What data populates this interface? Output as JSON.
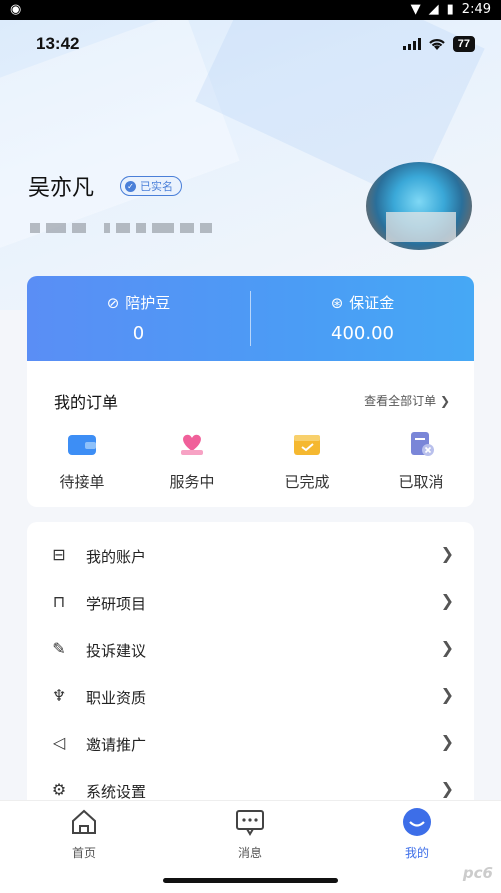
{
  "android_status": {
    "time": "2:49"
  },
  "ios_status": {
    "time": "13:42",
    "battery": "77"
  },
  "profile": {
    "name": "吴亦凡",
    "verified_label": "已实名"
  },
  "assets": [
    {
      "label": "陪护豆",
      "value": "0"
    },
    {
      "label": "保证金",
      "value": "400.00"
    }
  ],
  "orders": {
    "title": "我的订单",
    "view_all": "查看全部订单",
    "items": [
      {
        "label": "待接单",
        "icon": "wallet-icon",
        "color": "#3d8ef5"
      },
      {
        "label": "服务中",
        "icon": "heart-hand-icon",
        "color": "#f0609a"
      },
      {
        "label": "已完成",
        "icon": "box-check-icon",
        "color": "#f5b830"
      },
      {
        "label": "已取消",
        "icon": "doc-cancel-icon",
        "color": "#7a86d8"
      }
    ]
  },
  "menu": [
    {
      "label": "我的账户",
      "icon": "account-icon"
    },
    {
      "label": "学研项目",
      "icon": "bookmark-icon"
    },
    {
      "label": "投诉建议",
      "icon": "feedback-icon"
    },
    {
      "label": "职业资质",
      "icon": "trophy-icon"
    },
    {
      "label": "邀请推广",
      "icon": "megaphone-icon"
    },
    {
      "label": "系统设置",
      "icon": "gear-icon"
    }
  ],
  "tabs": [
    {
      "label": "首页",
      "icon": "home-icon"
    },
    {
      "label": "消息",
      "icon": "message-icon"
    },
    {
      "label": "我的",
      "icon": "profile-icon",
      "active": true
    }
  ],
  "watermark": "pc6"
}
